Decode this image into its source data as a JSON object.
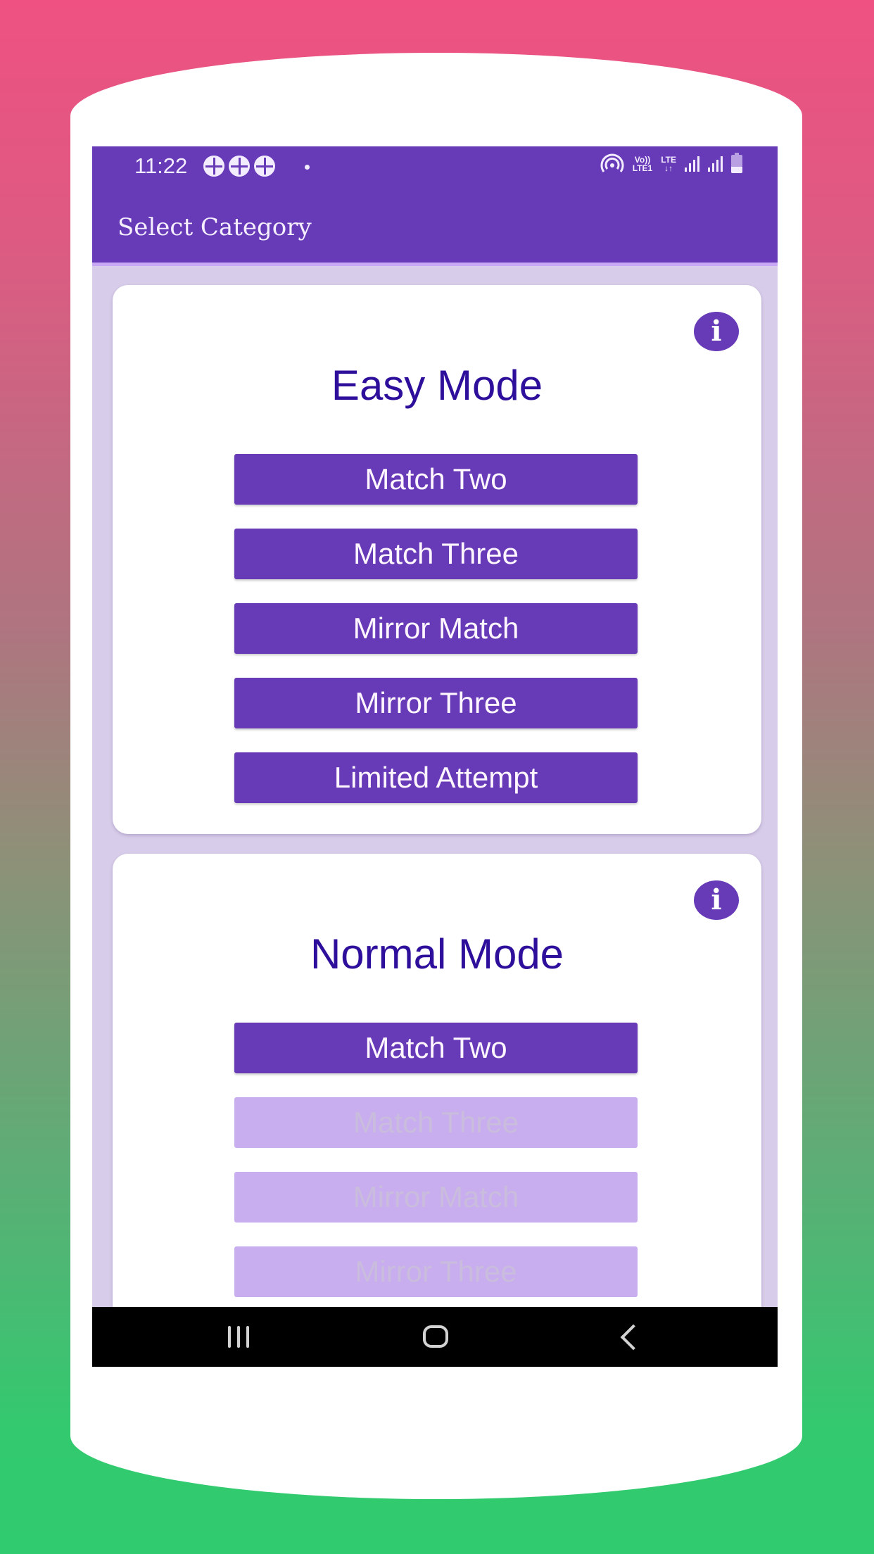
{
  "status_bar": {
    "time": "11:22",
    "notification_icons": [
      "pinwheel-icon",
      "pinwheel-icon",
      "pinwheel-icon"
    ],
    "network_labels": {
      "volte": "Vo))",
      "lte1": "LTE1",
      "lte": "LTE",
      "data_arrows": "↓↑"
    }
  },
  "app_bar": {
    "title": "Select Category"
  },
  "cards": [
    {
      "title": "Easy Mode",
      "buttons": [
        {
          "label": "Match Two",
          "enabled": true
        },
        {
          "label": "Match Three",
          "enabled": true
        },
        {
          "label": "Mirror Match",
          "enabled": true
        },
        {
          "label": "Mirror Three",
          "enabled": true
        },
        {
          "label": "Limited Attempt",
          "enabled": true
        }
      ]
    },
    {
      "title": "Normal Mode",
      "buttons": [
        {
          "label": "Match Two",
          "enabled": true
        },
        {
          "label": "Match Three",
          "enabled": false
        },
        {
          "label": "Mirror Match",
          "enabled": false
        },
        {
          "label": "Mirror Three",
          "enabled": false
        }
      ]
    }
  ],
  "info_icon_glyph": "i",
  "colors": {
    "primary": "#673AB7",
    "title_text": "#2E0F9C",
    "disabled_button": "#C8AEEF",
    "content_background": "#D7CCE9",
    "bg_gradient_top": "#EE5182",
    "bg_gradient_bottom": "#30CB6E"
  }
}
